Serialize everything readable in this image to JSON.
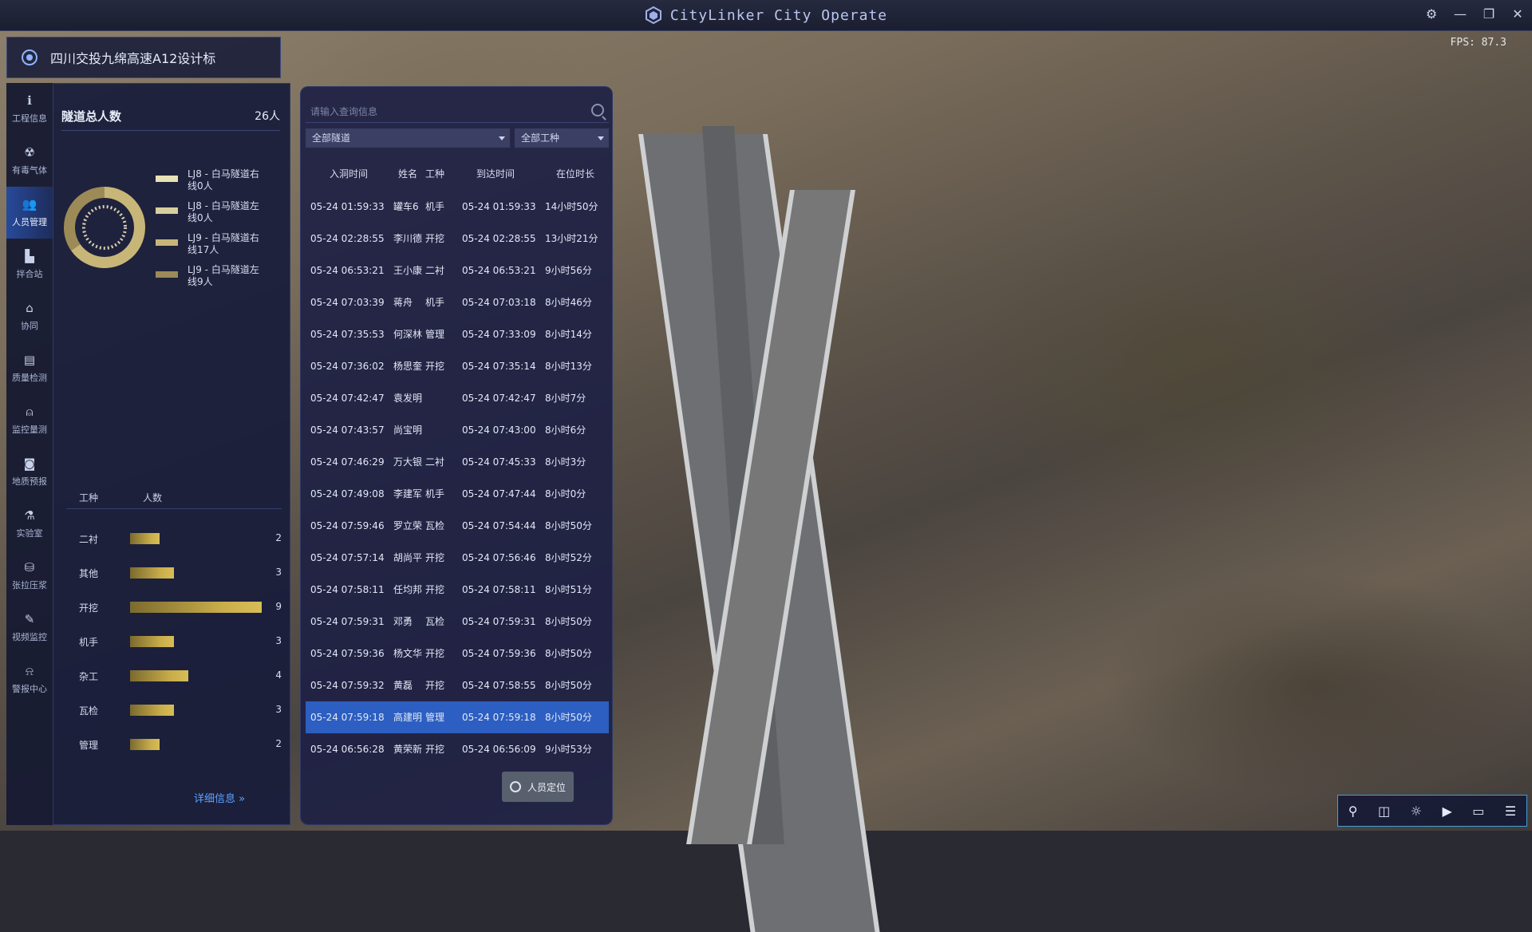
{
  "window": {
    "title": "CityLinker City Operate",
    "fps": "FPS: 87.3",
    "controls": [
      "⚙",
      "—",
      "❐",
      "✕"
    ]
  },
  "project": {
    "name": "四川交投九绵高速A12设计标"
  },
  "nav": [
    {
      "label": "工程信息",
      "icon": "info-icon",
      "glyph": "ℹ"
    },
    {
      "label": "有毒气体",
      "icon": "gas-icon",
      "glyph": "☢"
    },
    {
      "label": "人员管理",
      "icon": "people-icon",
      "glyph": "👥",
      "active": true
    },
    {
      "label": "拌合站",
      "icon": "plant-icon",
      "glyph": "▙"
    },
    {
      "label": "协同",
      "icon": "cooperate-icon",
      "glyph": "⌂"
    },
    {
      "label": "质量检测",
      "icon": "quality-icon",
      "glyph": "▤"
    },
    {
      "label": "监控量测",
      "icon": "monitor-icon",
      "glyph": "⍝"
    },
    {
      "label": "地质预报",
      "icon": "geology-icon",
      "glyph": "◙"
    },
    {
      "label": "实验室",
      "icon": "lab-icon",
      "glyph": "⚗"
    },
    {
      "label": "张拉压浆",
      "icon": "tension-icon",
      "glyph": "⛁"
    },
    {
      "label": "视频监控",
      "icon": "video-icon",
      "glyph": "✎"
    },
    {
      "label": "警报中心",
      "icon": "alarm-icon",
      "glyph": "⍾"
    }
  ],
  "stats": {
    "title": "隧道总人数",
    "total": "26人",
    "legend": [
      {
        "label": "LJ8 - 白马隧道右线0人",
        "count": 0,
        "color": "#e9e2b8"
      },
      {
        "label": "LJ8 - 白马隧道左线0人",
        "count": 0,
        "color": "#d8ce9e"
      },
      {
        "label": "LJ9 - 白马隧道右线17人",
        "count": 17,
        "color": "#c7b678"
      },
      {
        "label": "LJ9 - 白马隧道左线9人",
        "count": 9,
        "color": "#9c8a57"
      }
    ],
    "bar_header": {
      "col1": "工种",
      "col2": "人数"
    },
    "bars": [
      {
        "name": "二衬",
        "value": 2
      },
      {
        "name": "其他",
        "value": 3
      },
      {
        "name": "开挖",
        "value": 9
      },
      {
        "name": "机手",
        "value": 3
      },
      {
        "name": "杂工",
        "value": 4
      },
      {
        "name": "瓦检",
        "value": 3
      },
      {
        "name": "管理",
        "value": 2
      }
    ],
    "bar_max": 9,
    "detail_link": "详细信息 »"
  },
  "table": {
    "search_placeholder": "请输入查询信息",
    "filter_tunnel": "全部隧道",
    "filter_work": "全部工种",
    "headers": [
      "入洞时间",
      "姓名",
      "工种",
      "到达时间",
      "在位时长"
    ],
    "rows": [
      [
        "05-24 01:59:33",
        "罐车6",
        "机手",
        "05-24 01:59:33",
        "14小时50分"
      ],
      [
        "05-24 02:28:55",
        "李川德",
        "开挖",
        "05-24 02:28:55",
        "13小时21分"
      ],
      [
        "05-24 06:53:21",
        "王小康",
        "二衬",
        "05-24 06:53:21",
        "9小时56分"
      ],
      [
        "05-24 07:03:39",
        "蒋舟",
        "机手",
        "05-24 07:03:18",
        "8小时46分"
      ],
      [
        "05-24 07:35:53",
        "何深林",
        "管理",
        "05-24 07:33:09",
        "8小时14分"
      ],
      [
        "05-24 07:36:02",
        "杨思奎",
        "开挖",
        "05-24 07:35:14",
        "8小时13分"
      ],
      [
        "05-24 07:42:47",
        "袁发明",
        "",
        "05-24 07:42:47",
        "8小时7分"
      ],
      [
        "05-24 07:43:57",
        "尚宝明",
        "",
        "05-24 07:43:00",
        "8小时6分"
      ],
      [
        "05-24 07:46:29",
        "万大银",
        "二衬",
        "05-24 07:45:33",
        "8小时3分"
      ],
      [
        "05-24 07:49:08",
        "李建军",
        "机手",
        "05-24 07:47:44",
        "8小时0分"
      ],
      [
        "05-24 07:59:46",
        "罗立荣",
        "瓦检",
        "05-24 07:54:44",
        "8小时50分"
      ],
      [
        "05-24 07:57:14",
        "胡尚平",
        "开挖",
        "05-24 07:56:46",
        "8小时52分"
      ],
      [
        "05-24 07:58:11",
        "任均邦",
        "开挖",
        "05-24 07:58:11",
        "8小时51分"
      ],
      [
        "05-24 07:59:31",
        "邓勇",
        "瓦检",
        "05-24 07:59:31",
        "8小时50分"
      ],
      [
        "05-24 07:59:36",
        "杨文华",
        "开挖",
        "05-24 07:59:36",
        "8小时50分"
      ],
      [
        "05-24 07:59:32",
        "黄磊",
        "开挖",
        "05-24 07:58:55",
        "8小时50分"
      ],
      [
        "05-24 07:59:18",
        "高建明",
        "管理",
        "05-24 07:59:18",
        "8小时50分"
      ],
      [
        "05-24 06:56:28",
        "黄荣新",
        "开挖",
        "05-24 06:56:09",
        "9小时53分"
      ]
    ],
    "selected_row": 16,
    "locate_button": "人员定位"
  },
  "toolbar": [
    {
      "icon": "pin-icon",
      "glyph": "⚲"
    },
    {
      "icon": "camera-icon",
      "glyph": "◫"
    },
    {
      "icon": "sun-icon",
      "glyph": "☼"
    },
    {
      "icon": "video-record-icon",
      "glyph": "▶"
    },
    {
      "icon": "ruler-icon",
      "glyph": "▭"
    },
    {
      "icon": "layers-icon",
      "glyph": "☰"
    }
  ],
  "colors": {
    "accent": "#2c5fc1",
    "bar_gold": "#c9ad4a",
    "border_cyan": "#41a0d6"
  }
}
